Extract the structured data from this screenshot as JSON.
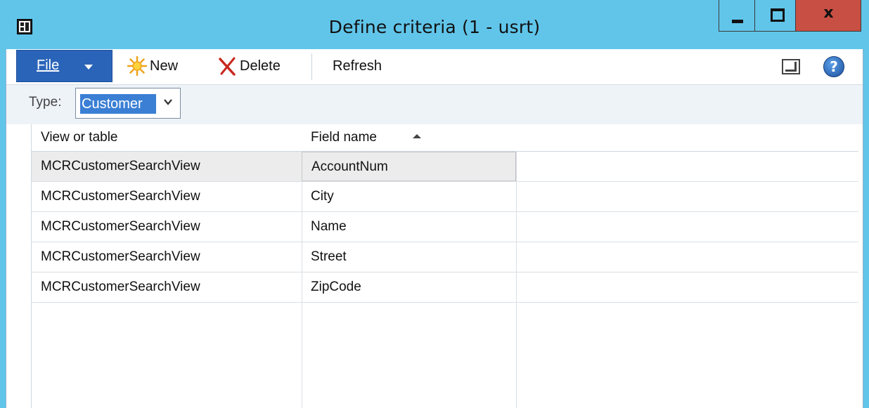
{
  "window": {
    "title": "Define criteria  (1 - usrt)",
    "close_glyph": "x"
  },
  "toolbar": {
    "file_label": "File",
    "new_label": "New",
    "delete_label": "Delete",
    "refresh_label": "Refresh",
    "help_glyph": "?"
  },
  "filter": {
    "type_label": "Type:",
    "type_value": "Customer"
  },
  "grid": {
    "columns": [
      "View or table",
      "Field name"
    ],
    "sort_column": "Field name",
    "sort_direction": "ascending",
    "rows": [
      [
        "MCRCustomerSearchView",
        "AccountNum"
      ],
      [
        "MCRCustomerSearchView",
        "City"
      ],
      [
        "MCRCustomerSearchView",
        "Name"
      ],
      [
        "MCRCustomerSearchView",
        "Street"
      ],
      [
        "MCRCustomerSearchView",
        "ZipCode"
      ]
    ],
    "selected_row": 0
  },
  "colors": {
    "titlebar": "#61c5ea",
    "close_button": "#c84f43",
    "file_button": "#2a64b9",
    "selection": "#3b7fd4"
  }
}
